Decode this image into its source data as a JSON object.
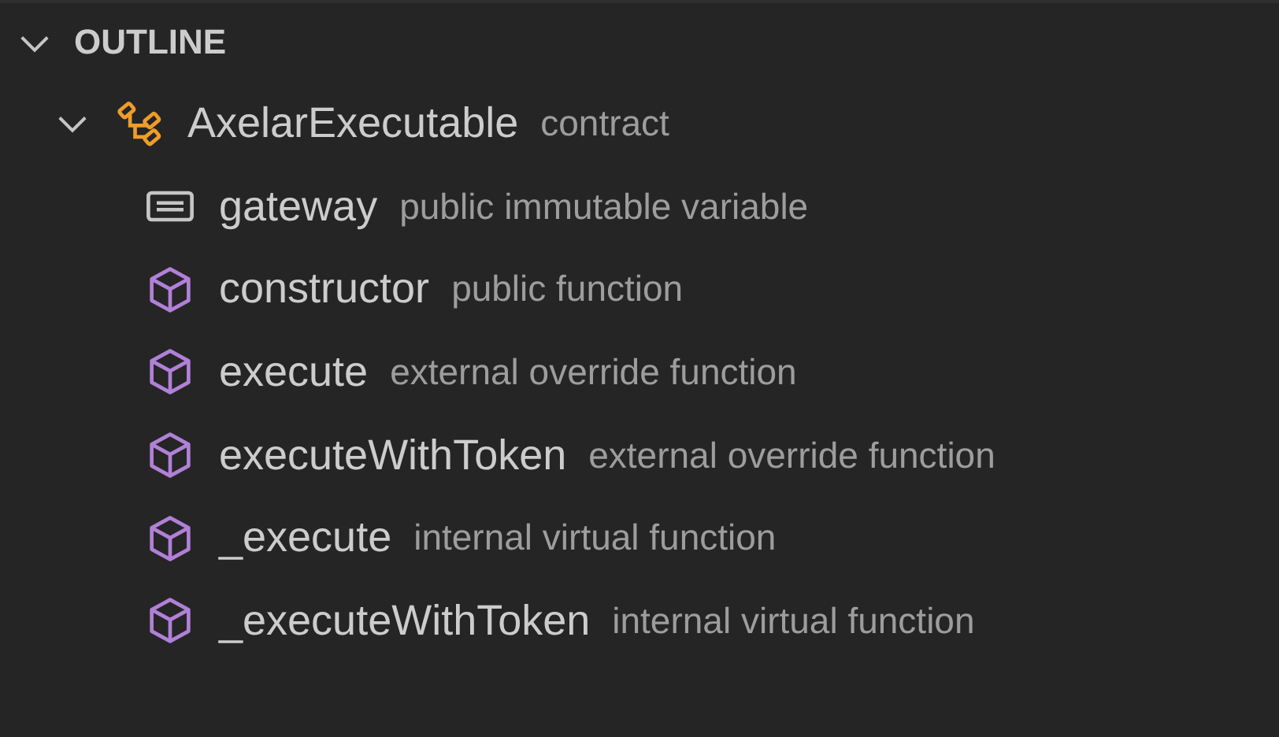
{
  "panel": {
    "title": "OUTLINE",
    "expanded": true
  },
  "tree": [
    {
      "kind": "contract",
      "name": "AxelarExecutable",
      "detail": "contract",
      "expanded": true,
      "children": [
        {
          "kind": "variable",
          "name": "gateway",
          "detail": "public immutable variable"
        },
        {
          "kind": "function",
          "name": "constructor",
          "detail": "public function"
        },
        {
          "kind": "function",
          "name": "execute",
          "detail": "external override function"
        },
        {
          "kind": "function",
          "name": "executeWithToken",
          "detail": "external override function"
        },
        {
          "kind": "function",
          "name": "_execute",
          "detail": "internal virtual function"
        },
        {
          "kind": "function",
          "name": "_executeWithToken",
          "detail": "internal virtual function"
        }
      ]
    }
  ]
}
